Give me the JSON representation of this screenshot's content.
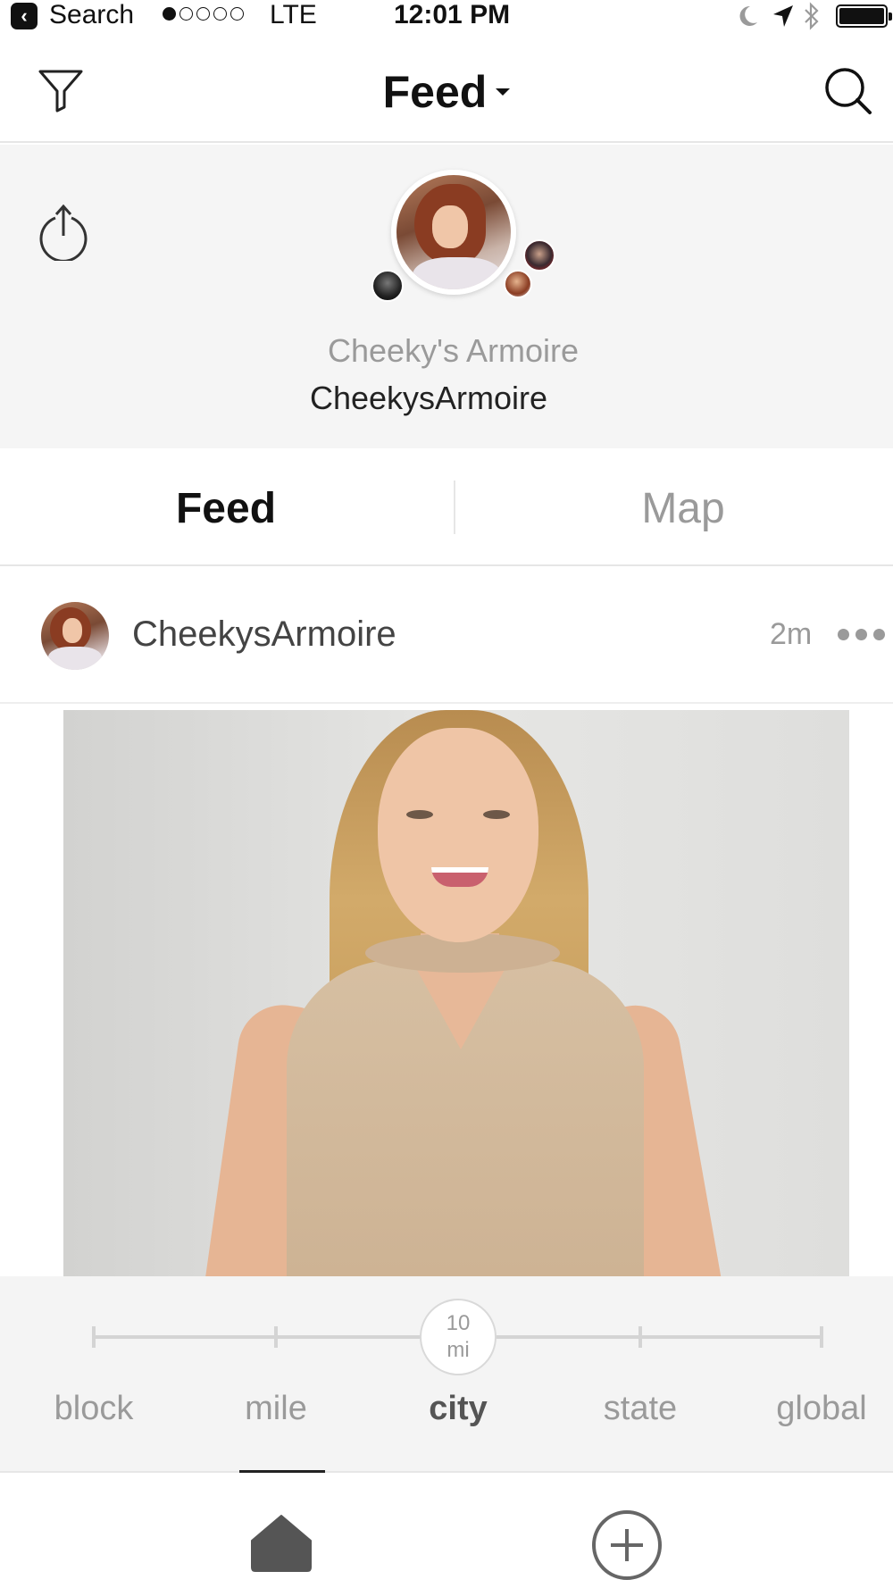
{
  "status_bar": {
    "back_label": "Search",
    "carrier": "LTE",
    "time": "12:01 PM",
    "signal_bars_filled": 1,
    "signal_bars_total": 5
  },
  "nav_bar": {
    "title": "Feed",
    "filter_icon": "filter-funnel-icon",
    "search_icon": "search-icon"
  },
  "profile": {
    "display_name": "Cheeky's Armoire",
    "username": "CheekysArmoire",
    "share_icon": "share-icon"
  },
  "tabs": [
    {
      "label": "Feed",
      "active": true
    },
    {
      "label": "Map",
      "active": false
    }
  ],
  "post": {
    "username": "CheekysArmoire",
    "time": "2m",
    "more_icon": "more-dots-icon"
  },
  "radius_slider": {
    "selected_index": 2,
    "knob_value": "10",
    "knob_unit": "mi",
    "labels": [
      "block",
      "mile",
      "city",
      "state",
      "global"
    ]
  },
  "bottom_tabs": {
    "home_icon": "home-icon",
    "add_icon": "add-circle-icon"
  },
  "colors": {
    "header_bg": "#f5f5f5",
    "inactive_text": "#9a9a9a",
    "active_text": "#111111"
  }
}
